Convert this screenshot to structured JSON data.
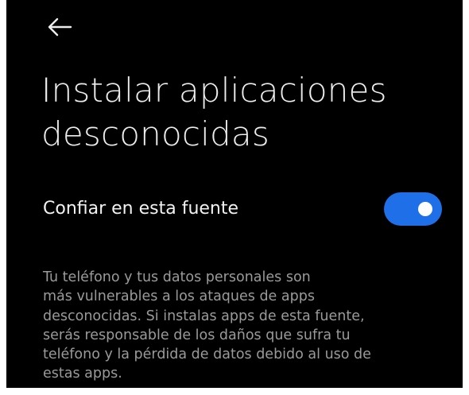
{
  "header": {
    "back_icon": "arrow-left-icon"
  },
  "page": {
    "title": "Instalar aplicaciones\ndesconocidas"
  },
  "setting": {
    "label": "Confiar en esta fuente",
    "toggle_state": "on",
    "toggle_color": "#1f70e8"
  },
  "description": {
    "text": "Tu teléfono y tus datos personales son\nmás vulnerables a los ataques de apps\ndesconocidas. Si instalas apps de esta fuente,\nserás responsable de los daños que sufra tu\nteléfono y la pérdida de datos debido al uso de\nestas apps."
  }
}
